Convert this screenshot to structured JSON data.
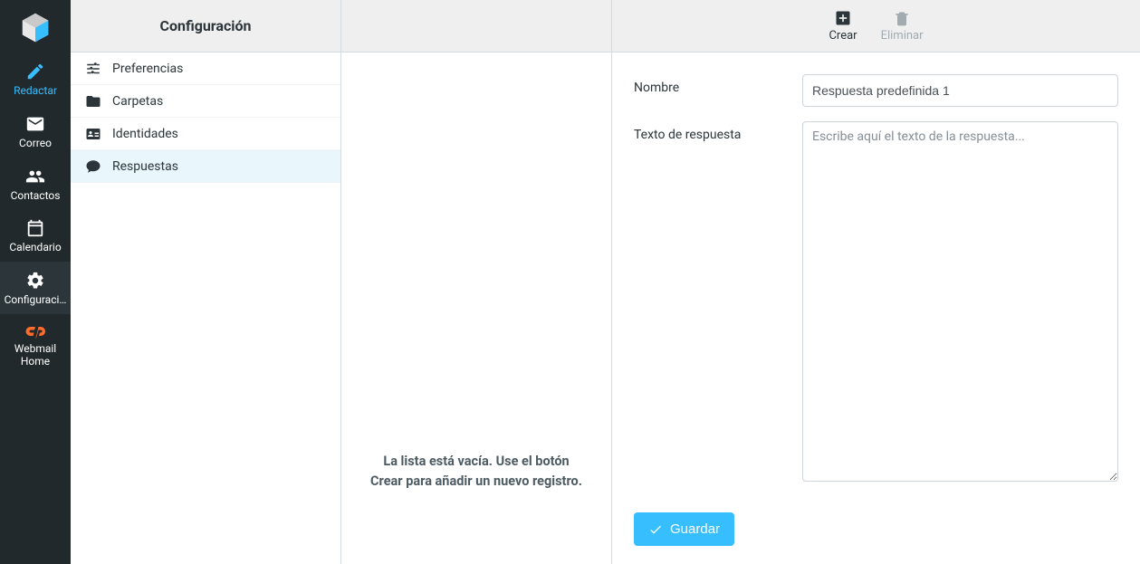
{
  "nav": {
    "items": [
      {
        "id": "compose",
        "label": "Redactar"
      },
      {
        "id": "mail",
        "label": "Correo"
      },
      {
        "id": "contacts",
        "label": "Contactos"
      },
      {
        "id": "calendar",
        "label": "Calendario"
      },
      {
        "id": "settings",
        "label": "Configuraci…"
      },
      {
        "id": "webmail",
        "label": "Webmail\nHome"
      }
    ]
  },
  "settings": {
    "title": "Configuración",
    "items": [
      {
        "id": "preferences",
        "label": "Preferencias"
      },
      {
        "id": "folders",
        "label": "Carpetas"
      },
      {
        "id": "identities",
        "label": "Identidades"
      },
      {
        "id": "responses",
        "label": "Respuestas"
      }
    ]
  },
  "middle": {
    "empty_message": "La lista está vacía. Use el botón Crear para añadir un nuevo registro."
  },
  "toolbar": {
    "create_label": "Crear",
    "delete_label": "Eliminar"
  },
  "form": {
    "name_label": "Nombre",
    "name_value": "Respuesta predefinida 1",
    "text_label": "Texto de respuesta",
    "text_placeholder": "Escribe aquí el texto de la respuesta...",
    "text_value": "",
    "save_label": "Guardar"
  }
}
